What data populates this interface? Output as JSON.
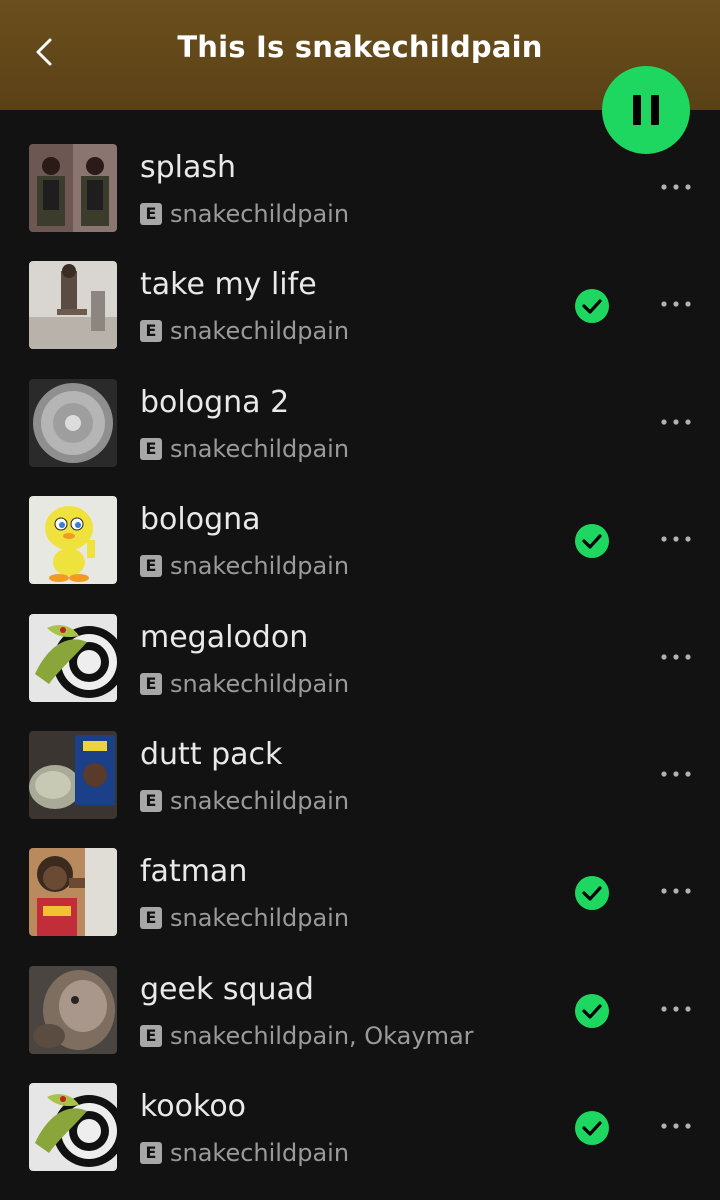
{
  "header": {
    "title": "This Is snakechildpain"
  },
  "colors": {
    "accent": "#1ed760",
    "header_bg": "#6b4f1d",
    "background": "#121212"
  },
  "tracks": [
    {
      "title": "splash",
      "artist": "snakechildpain",
      "explicit": "E",
      "downloaded": false
    },
    {
      "title": "take my life",
      "artist": "snakechildpain",
      "explicit": "E",
      "downloaded": true
    },
    {
      "title": "bologna 2",
      "artist": "snakechildpain",
      "explicit": "E",
      "downloaded": false
    },
    {
      "title": "bologna",
      "artist": "snakechildpain",
      "explicit": "E",
      "downloaded": true
    },
    {
      "title": "megalodon",
      "artist": "snakechildpain",
      "explicit": "E",
      "downloaded": false
    },
    {
      "title": "dutt pack",
      "artist": "snakechildpain",
      "explicit": "E",
      "downloaded": false
    },
    {
      "title": "fatman",
      "artist": "snakechildpain",
      "explicit": "E",
      "downloaded": true
    },
    {
      "title": "geek squad",
      "artist": "snakechildpain, Okaymar",
      "explicit": "E",
      "downloaded": true
    },
    {
      "title": "kookoo",
      "artist": "snakechildpain",
      "explicit": "E",
      "downloaded": true
    }
  ]
}
